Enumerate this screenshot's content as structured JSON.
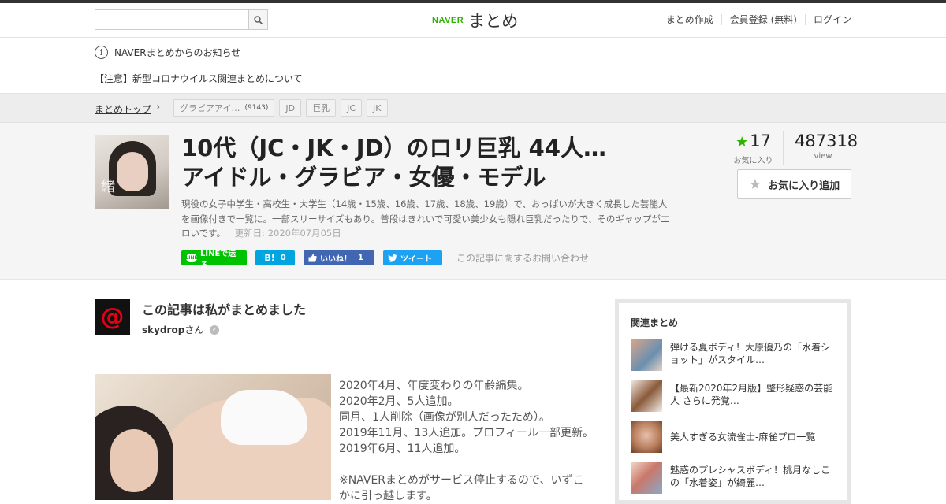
{
  "header": {
    "search_placeholder": "",
    "logo_brand": "NAVER",
    "logo_service": "まとめ",
    "nav": [
      "まとめ作成",
      "会員登録 (無料)",
      "ログイン"
    ]
  },
  "notice": {
    "title": "NAVERまとめからのお知らせ",
    "link": "【注意】新型コロナウイルス関連まとめについて"
  },
  "breadcrumb": {
    "top": "まとめトップ",
    "tags": [
      {
        "label": "グラビアアイ…",
        "count": "(9143)"
      },
      {
        "label": "JD",
        "count": ""
      },
      {
        "label": "巨乳",
        "count": ""
      },
      {
        "label": "JC",
        "count": ""
      },
      {
        "label": "JK",
        "count": ""
      }
    ]
  },
  "article": {
    "title_line1": "10代（JC・JK・JD）のロリ巨乳 44人…",
    "title_line2": "アイドル・グラビア・女優・モデル",
    "description": "現役の女子中学生・高校生・大学生（14歳・15歳、16歳、17歳、18歳、19歳）で、おっぱいが大きく成長した芸能人を画像付きで一覧に。一部スリーサイズもあり。普段はきれいで可愛い美少女も隠れ巨乳だったりで、そのギャップがエロいです。",
    "updated": "更新日: 2020年07月05日",
    "thumb_overlay": "緒",
    "favorites": "17",
    "favorites_label": "お気に入り",
    "views": "487318",
    "views_label": "view",
    "fav_button": "お気に入り追加"
  },
  "social": {
    "line": "LINEで送る",
    "hatena_icon": "B!",
    "hatena_count": "0",
    "facebook": "いいね！",
    "facebook_count": "1",
    "twitter": "ツイート",
    "contact": "この記事に関するお問い合わせ"
  },
  "author": {
    "heading": "この記事は私がまとめました",
    "name": "skydrop",
    "suffix": "さん",
    "avatar_symbol": "@"
  },
  "body_lines": [
    "2020年4月、年度変わりの年齢編集。",
    "2020年2月、5人追加。",
    "同月、1人削除（画像が別人だったため）。",
    "2019年11月、13人追加。プロフィール一部更新。",
    "2019年6月、11人追加。",
    "",
    "※NAVERまとめがサービス停止するので、いずこ",
    "かに引っ越します。"
  ],
  "sidebar": {
    "title": "関連まとめ",
    "items": [
      {
        "text": "弾ける夏ボディ！大原優乃の「水着ショット」がスタイル…"
      },
      {
        "text": "【最新2020年2月版】整形疑惑の芸能人 さらに発覚…"
      },
      {
        "text": "美人すぎる女流雀士-麻雀プロ一覧"
      },
      {
        "text": "魅惑のプレシャスボディ！桃月なしこの「水着姿」が綺麗…"
      }
    ]
  },
  "colors": {
    "naver_green": "#2db400",
    "line_green": "#00c300",
    "hatena_blue": "#00a4de",
    "facebook_blue": "#4267b2",
    "twitter_blue": "#1da1f2"
  }
}
